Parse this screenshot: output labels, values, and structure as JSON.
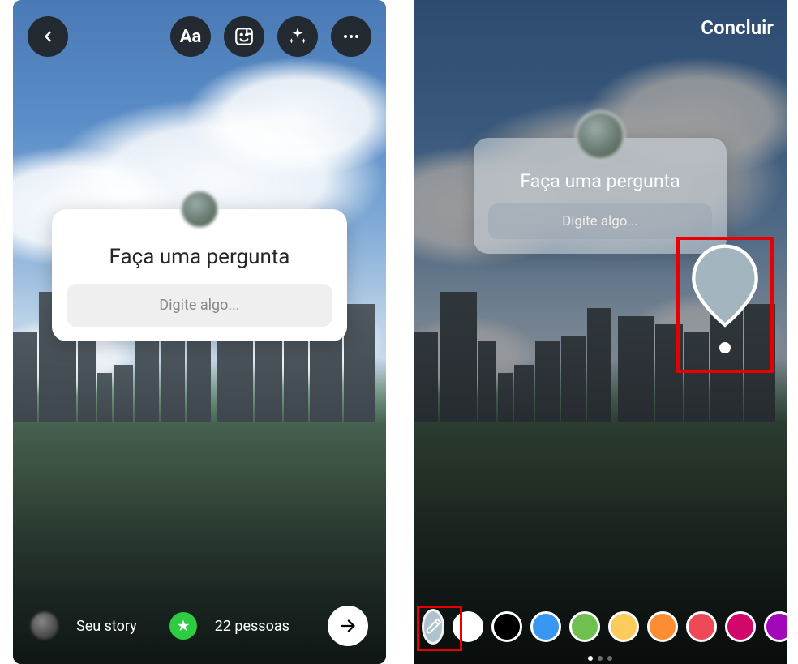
{
  "left": {
    "toolbar": {
      "back_icon": "back-chevron",
      "text_tool": "Aa",
      "sticker_icon": "sticker",
      "effects_icon": "sparkles",
      "more_icon": "more-dots"
    },
    "sticker": {
      "prompt": "Faça uma pergunta",
      "placeholder": "Digite algo..."
    },
    "bottom": {
      "your_story": "Seu story",
      "close_friends": "22 pessoas",
      "send_icon": "arrow-right"
    }
  },
  "right": {
    "done": "Concluir",
    "sticker": {
      "prompt": "Faça uma pergunta",
      "placeholder": "Digite algo..."
    },
    "eyedropper_color": "#a3b6c0",
    "palette": [
      {
        "name": "eyedropper",
        "color": "#afc3cf"
      },
      {
        "name": "white",
        "color": "#ffffff"
      },
      {
        "name": "black",
        "color": "#000000"
      },
      {
        "name": "blue",
        "color": "#3897f0"
      },
      {
        "name": "green",
        "color": "#70c050"
      },
      {
        "name": "yellow",
        "color": "#fdcb5c"
      },
      {
        "name": "orange",
        "color": "#fd8d32"
      },
      {
        "name": "red",
        "color": "#ed4956"
      },
      {
        "name": "pink",
        "color": "#d10869"
      },
      {
        "name": "purple",
        "color": "#a307ba"
      }
    ],
    "page_indicator": {
      "pages": 3,
      "active": 0
    }
  }
}
